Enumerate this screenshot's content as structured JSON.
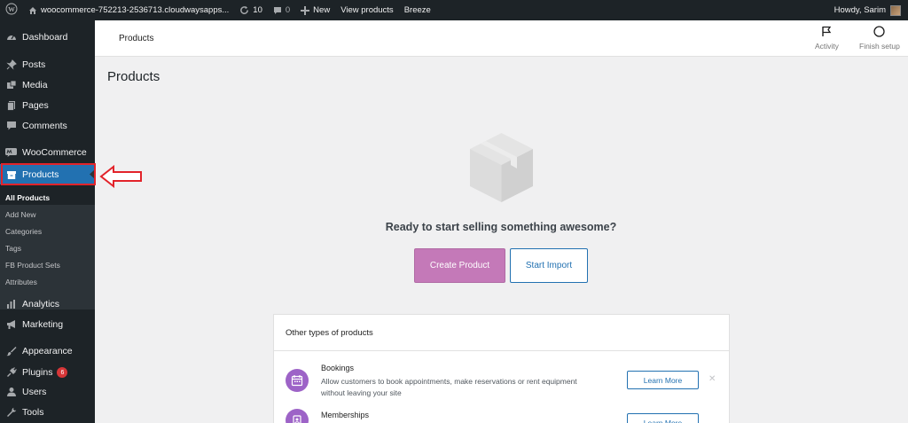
{
  "admin_bar": {
    "site_name": "woocommerce-752213-2536713.cloudwaysapps...",
    "updates_count": "10",
    "comments_count": "0",
    "new_label": "New",
    "view_products_label": "View products",
    "breeze_label": "Breeze",
    "howdy_label": "Howdy, Sarim"
  },
  "sidebar": {
    "dashboard": "Dashboard",
    "posts": "Posts",
    "media": "Media",
    "pages": "Pages",
    "comments": "Comments",
    "woocommerce": "WooCommerce",
    "products": "Products",
    "submenu": {
      "all_products": "All Products",
      "add_new": "Add New",
      "categories": "Categories",
      "tags": "Tags",
      "fb_product_sets": "FB Product Sets",
      "attributes": "Attributes"
    },
    "analytics": "Analytics",
    "marketing": "Marketing",
    "appearance": "Appearance",
    "plugins": "Plugins",
    "plugins_badge": "6",
    "users": "Users",
    "tools": "Tools"
  },
  "header": {
    "title": "Products",
    "activity_label": "Activity",
    "finish_setup_label": "Finish setup"
  },
  "main": {
    "page_title": "Products",
    "ready_text": "Ready to start selling something awesome?",
    "create_product_label": "Create Product",
    "start_import_label": "Start Import"
  },
  "other_types": {
    "heading": "Other types of products",
    "items": [
      {
        "title": "Bookings",
        "description": "Allow customers to book appointments, make reservations or rent equipment without leaving your site",
        "button_label": "Learn More"
      },
      {
        "title": "Memberships",
        "description": "",
        "button_label": "Learn More"
      }
    ]
  },
  "colors": {
    "admin_dark": "#1d2327",
    "active_blue": "#2271b1",
    "woo_purple": "#c479b8",
    "highlight_red": "#e2232a"
  }
}
